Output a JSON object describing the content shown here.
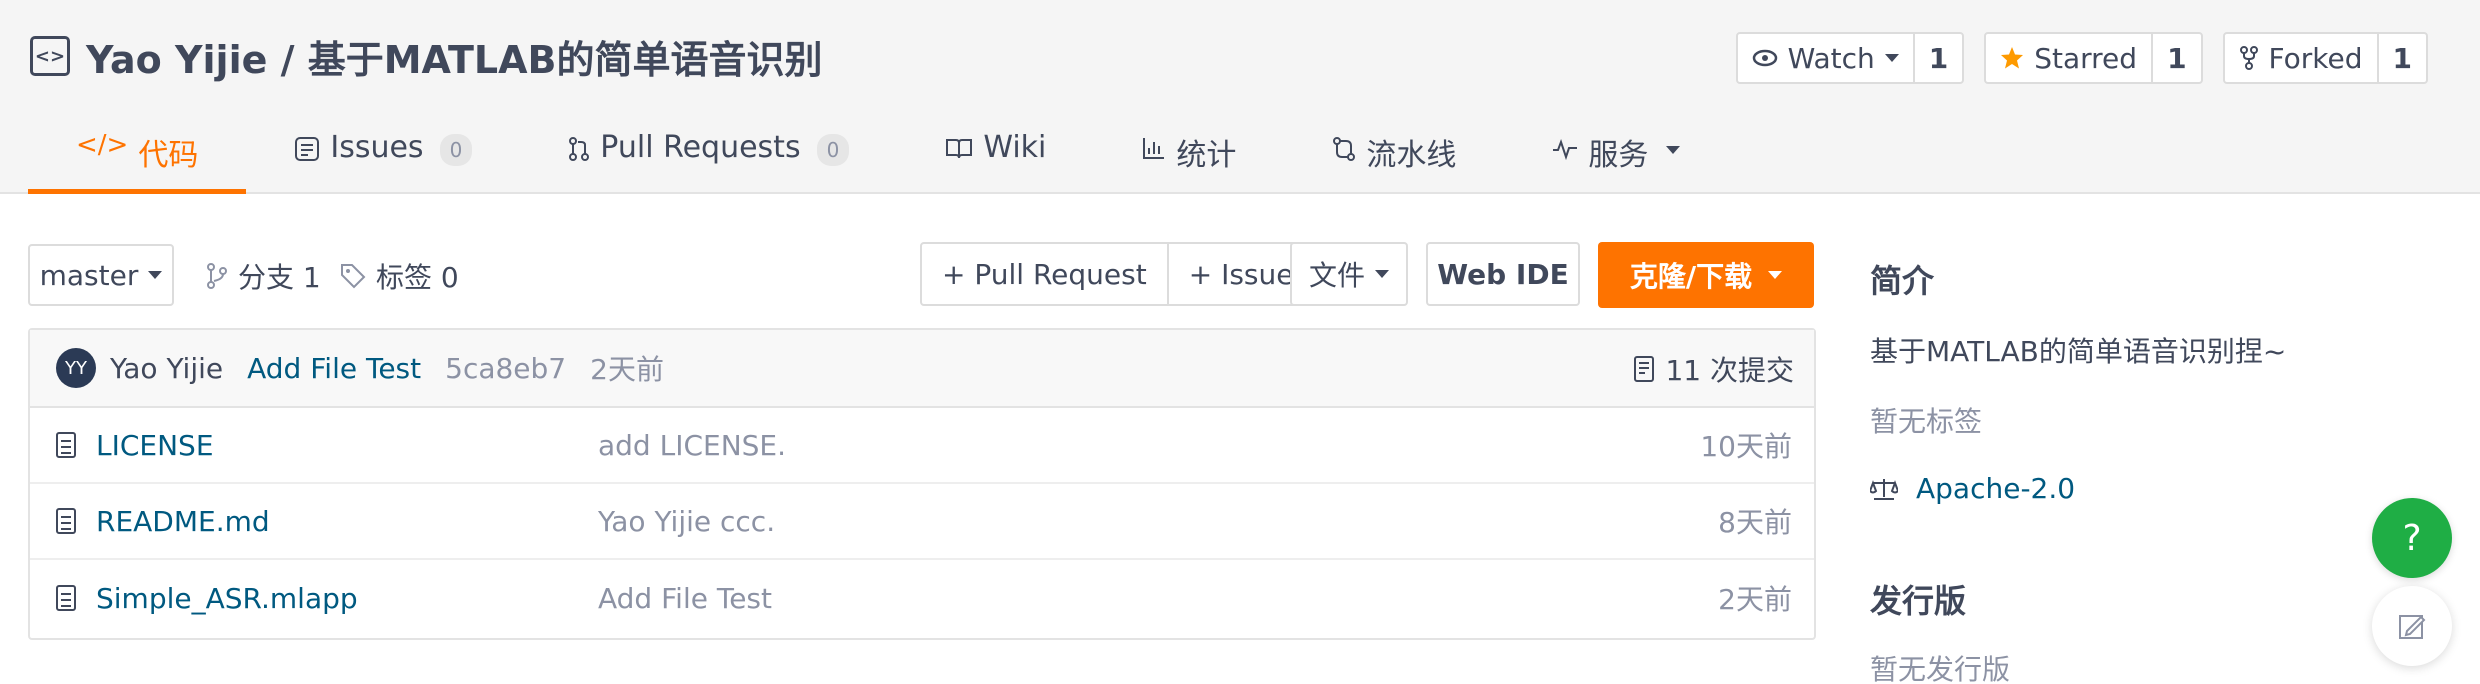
{
  "repo": {
    "title": "Yao Yijie / 基于MATLAB的简单语音识别",
    "watch": {
      "label": "Watch",
      "count": "1"
    },
    "star": {
      "label": "Starred",
      "count": "1"
    },
    "fork": {
      "label": "Forked",
      "count": "1"
    }
  },
  "tabs": [
    {
      "label": "代码",
      "active": true
    },
    {
      "label": "Issues",
      "badge": "0"
    },
    {
      "label": "Pull Requests",
      "badge": "0"
    },
    {
      "label": "Wiki"
    },
    {
      "label": "统计"
    },
    {
      "label": "流水线"
    },
    {
      "label": "服务"
    }
  ],
  "toolbar": {
    "branch": "master",
    "branches": "分支 1",
    "tags": "标签 0",
    "pull_request": "+ Pull Request",
    "issue": "+ Issue",
    "files": "文件",
    "web_ide": "Web IDE",
    "clone": "克隆/下载"
  },
  "commit": {
    "avatar": "YY",
    "author": "Yao Yijie",
    "message": "Add File Test",
    "sha": "5ca8eb7",
    "time": "2天前",
    "count": "11 次提交"
  },
  "files": [
    {
      "name": "LICENSE",
      "message": "add LICENSE.",
      "time": "10天前"
    },
    {
      "name": "README.md",
      "message": "Yao Yijie ccc.",
      "time": "8天前"
    },
    {
      "name": "Simple_ASR.mlapp",
      "message": "Add File Test",
      "time": "2天前"
    }
  ],
  "sidebar": {
    "intro_title": "简介",
    "description": "基于MATLAB的简单语音识别捏~",
    "no_tags": "暂无标签",
    "license": "Apache-2.0",
    "release_title": "发行版",
    "no_release": "暂无发行版"
  },
  "colors": {
    "accent": "#fe7300",
    "link": "#005980",
    "help": "#1fae45"
  }
}
